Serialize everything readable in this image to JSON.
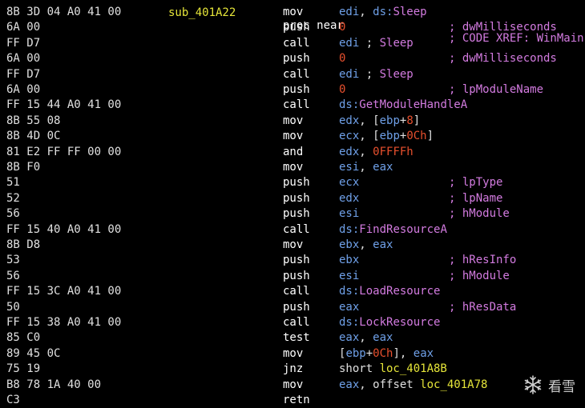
{
  "header": {
    "label": "sub_401A22",
    "text": "proc near",
    "comment": "; CODE XREF: WinMain"
  },
  "rows": [
    {
      "bytes": "8B 3D 04 A0 41 00",
      "mnem": "mov",
      "ops": [
        {
          "t": "edi",
          "c": "reg"
        },
        {
          "t": ", ",
          "c": "plain"
        },
        {
          "t": "ds:",
          "c": "reg"
        },
        {
          "t": "Sleep",
          "c": "api"
        }
      ],
      "comment": ""
    },
    {
      "bytes": "6A 00",
      "mnem": "push",
      "ops": [
        {
          "t": "0",
          "c": "num"
        }
      ],
      "comment": "; dwMilliseconds"
    },
    {
      "bytes": "FF D7",
      "mnem": "call",
      "ops": [
        {
          "t": "edi",
          "c": "reg"
        },
        {
          "t": " ; ",
          "c": "plain"
        },
        {
          "t": "Sleep",
          "c": "api"
        }
      ],
      "comment": ""
    },
    {
      "bytes": "6A 00",
      "mnem": "push",
      "ops": [
        {
          "t": "0",
          "c": "num"
        }
      ],
      "comment": "; dwMilliseconds"
    },
    {
      "bytes": "FF D7",
      "mnem": "call",
      "ops": [
        {
          "t": "edi",
          "c": "reg"
        },
        {
          "t": " ; ",
          "c": "plain"
        },
        {
          "t": "Sleep",
          "c": "api"
        }
      ],
      "comment": ""
    },
    {
      "bytes": "6A 00",
      "mnem": "push",
      "ops": [
        {
          "t": "0",
          "c": "num"
        }
      ],
      "comment": "; lpModuleName"
    },
    {
      "bytes": "FF 15 44 A0 41 00",
      "mnem": "call",
      "ops": [
        {
          "t": "ds:",
          "c": "reg"
        },
        {
          "t": "GetModuleHandleA",
          "c": "api"
        }
      ],
      "comment": ""
    },
    {
      "bytes": "8B 55 08",
      "mnem": "mov",
      "ops": [
        {
          "t": "edx",
          "c": "reg"
        },
        {
          "t": ", [",
          "c": "plain"
        },
        {
          "t": "ebp",
          "c": "reg"
        },
        {
          "t": "+",
          "c": "plain"
        },
        {
          "t": "8",
          "c": "num"
        },
        {
          "t": "]",
          "c": "plain"
        }
      ],
      "comment": ""
    },
    {
      "bytes": "8B 4D 0C",
      "mnem": "mov",
      "ops": [
        {
          "t": "ecx",
          "c": "reg"
        },
        {
          "t": ", [",
          "c": "plain"
        },
        {
          "t": "ebp",
          "c": "reg"
        },
        {
          "t": "+",
          "c": "plain"
        },
        {
          "t": "0Ch",
          "c": "num"
        },
        {
          "t": "]",
          "c": "plain"
        }
      ],
      "comment": ""
    },
    {
      "bytes": "81 E2 FF FF 00 00",
      "mnem": "and",
      "ops": [
        {
          "t": "edx",
          "c": "reg"
        },
        {
          "t": ", ",
          "c": "plain"
        },
        {
          "t": "0FFFFh",
          "c": "num"
        }
      ],
      "comment": ""
    },
    {
      "bytes": "8B F0",
      "mnem": "mov",
      "ops": [
        {
          "t": "esi",
          "c": "reg"
        },
        {
          "t": ", ",
          "c": "plain"
        },
        {
          "t": "eax",
          "c": "reg"
        }
      ],
      "comment": ""
    },
    {
      "bytes": "51",
      "mnem": "push",
      "ops": [
        {
          "t": "ecx",
          "c": "reg"
        }
      ],
      "comment": "; lpType"
    },
    {
      "bytes": "52",
      "mnem": "push",
      "ops": [
        {
          "t": "edx",
          "c": "reg"
        }
      ],
      "comment": "; lpName"
    },
    {
      "bytes": "56",
      "mnem": "push",
      "ops": [
        {
          "t": "esi",
          "c": "reg"
        }
      ],
      "comment": "; hModule"
    },
    {
      "bytes": "FF 15 40 A0 41 00",
      "mnem": "call",
      "ops": [
        {
          "t": "ds:",
          "c": "reg"
        },
        {
          "t": "FindResourceA",
          "c": "api"
        }
      ],
      "comment": ""
    },
    {
      "bytes": "8B D8",
      "mnem": "mov",
      "ops": [
        {
          "t": "ebx",
          "c": "reg"
        },
        {
          "t": ", ",
          "c": "plain"
        },
        {
          "t": "eax",
          "c": "reg"
        }
      ],
      "comment": ""
    },
    {
      "bytes": "53",
      "mnem": "push",
      "ops": [
        {
          "t": "ebx",
          "c": "reg"
        }
      ],
      "comment": "; hResInfo"
    },
    {
      "bytes": "56",
      "mnem": "push",
      "ops": [
        {
          "t": "esi",
          "c": "reg"
        }
      ],
      "comment": "; hModule"
    },
    {
      "bytes": "FF 15 3C A0 41 00",
      "mnem": "call",
      "ops": [
        {
          "t": "ds:",
          "c": "reg"
        },
        {
          "t": "LoadResource",
          "c": "api"
        }
      ],
      "comment": ""
    },
    {
      "bytes": "50",
      "mnem": "push",
      "ops": [
        {
          "t": "eax",
          "c": "reg"
        }
      ],
      "comment": "; hResData"
    },
    {
      "bytes": "FF 15 38 A0 41 00",
      "mnem": "call",
      "ops": [
        {
          "t": "ds:",
          "c": "reg"
        },
        {
          "t": "LockResource",
          "c": "api"
        }
      ],
      "comment": ""
    },
    {
      "bytes": "85 C0",
      "mnem": "test",
      "ops": [
        {
          "t": "eax",
          "c": "reg"
        },
        {
          "t": ", ",
          "c": "plain"
        },
        {
          "t": "eax",
          "c": "reg"
        }
      ],
      "comment": ""
    },
    {
      "bytes": "89 45 0C",
      "mnem": "mov",
      "ops": [
        {
          "t": "[",
          "c": "plain"
        },
        {
          "t": "ebp",
          "c": "reg"
        },
        {
          "t": "+",
          "c": "plain"
        },
        {
          "t": "0Ch",
          "c": "num"
        },
        {
          "t": "], ",
          "c": "plain"
        },
        {
          "t": "eax",
          "c": "reg"
        }
      ],
      "comment": ""
    },
    {
      "bytes": "75 19",
      "mnem": "jnz",
      "ops": [
        {
          "t": "short ",
          "c": "plain"
        },
        {
          "t": "loc_401A8B",
          "c": "lbl"
        }
      ],
      "comment": ""
    },
    {
      "bytes": "B8 78 1A 40 00",
      "mnem": "mov",
      "ops": [
        {
          "t": "eax",
          "c": "reg"
        },
        {
          "t": ", offset ",
          "c": "plain"
        },
        {
          "t": "loc_401A78",
          "c": "lbl"
        }
      ],
      "comment": ""
    },
    {
      "bytes": "C3",
      "mnem": "retn",
      "ops": [],
      "comment": ""
    }
  ],
  "watermark": {
    "icon": "snowflake-icon",
    "text": "看雪"
  },
  "colors": {
    "background": "#000000",
    "register": "#6fa0e8",
    "number": "#e8502e",
    "api_comment": "#d37be0",
    "label": "#e5e539",
    "mnemonic": "#ffffff"
  }
}
